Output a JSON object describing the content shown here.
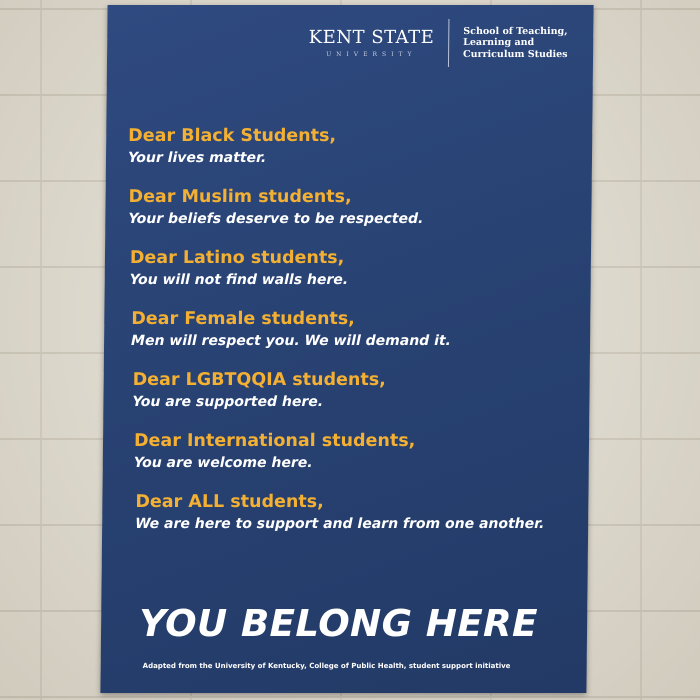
{
  "poster": {
    "logo": {
      "name": "KENT STATE",
      "sub": "UNIVERSITY"
    },
    "school": [
      "School of Teaching,",
      "Learning and",
      "Curriculum Studies"
    ],
    "messages": [
      {
        "heading": "Dear Black Students,",
        "body": "Your lives matter."
      },
      {
        "heading": "Dear Muslim students,",
        "body": "Your beliefs deserve to be respected."
      },
      {
        "heading": "Dear Latino students,",
        "body": "You will not find walls here."
      },
      {
        "heading": "Dear Female students,",
        "body": "Men will respect you. We will demand it."
      },
      {
        "heading": "Dear LGBTQQIA students,",
        "body": "You are supported here."
      },
      {
        "heading": "Dear International students,",
        "body": "You are welcome here."
      },
      {
        "heading": "Dear ALL students,",
        "body": "We are here to support and learn from one another."
      }
    ],
    "slogan": "YOU BELONG HERE",
    "credit": "Adapted from the University of Kentucky, College of Public Health, student support initiative"
  },
  "colors": {
    "poster_blue": "#2b4577",
    "heading_gold": "#f4b032",
    "wall": "#e4dfd3"
  }
}
